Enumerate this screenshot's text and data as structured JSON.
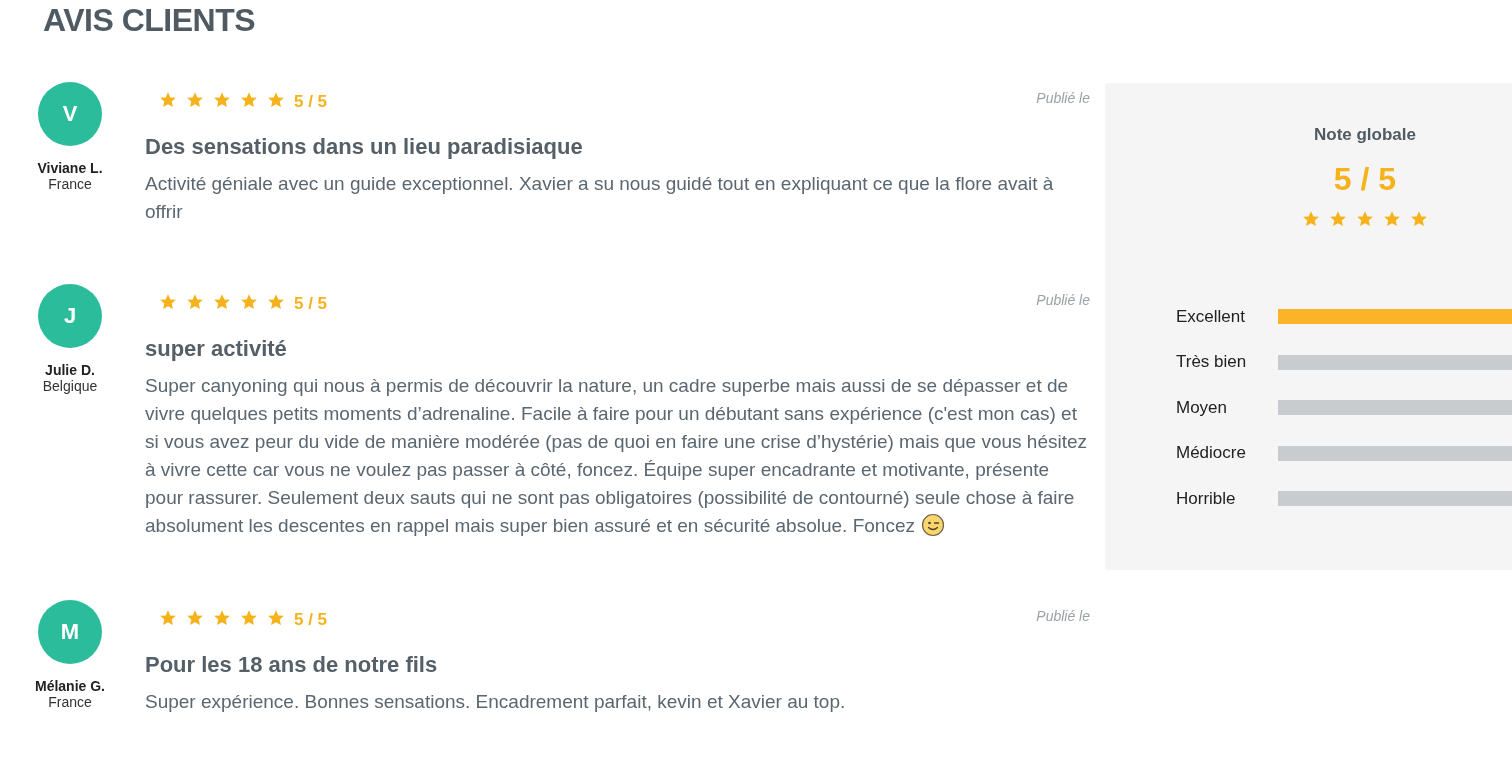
{
  "heading": "AVIS CLIENTS",
  "reviews": [
    {
      "initial": "V",
      "name": "Viviane L.",
      "country": "France",
      "stars": 5,
      "rating": "5 / 5",
      "published": "Publié le",
      "title": "Des sensations dans un lieu paradisiaque",
      "body": "Activité géniale avec un guide exceptionnel. Xavier a su nous guidé tout en expliquant ce que la flore avait à offrir",
      "emoji": false
    },
    {
      "initial": "J",
      "name": "Julie D.",
      "country": "Belgique",
      "stars": 5,
      "rating": "5 / 5",
      "published": "Publié le",
      "title": "super activité",
      "body": "Super canyoning qui nous à permis de découvrir la nature, un cadre superbe mais aussi de se dépasser et de vivre quelques petits moments d’adrenaline. Facile à faire pour un débutant sans expérience (c'est mon cas) et si vous avez peur du vide de manière modérée (pas de quoi en faire une crise d’hystérie) mais que vous hésitez à vivre cette car vous ne voulez pas passer à côté, foncez. Équipe super encadrante et motivante, présente pour rassurer. Seulement deux sauts qui ne sont pas obligatoires (possibilité de contourné) seule chose à faire absolument les descentes en rappel mais super bien assuré et en sécurité absolue. Foncez",
      "emoji": true
    },
    {
      "initial": "M",
      "name": "Mélanie G.",
      "country": "France",
      "stars": 5,
      "rating": "5 / 5",
      "published": "Publié le",
      "title": "Pour les 18 ans de notre fils",
      "body": "Super expérience. Bonnes sensations. Encadrement parfait, kevin et Xavier au top.",
      "emoji": false
    }
  ],
  "summary": {
    "title": "Note globale",
    "score": "5 / 5",
    "stars": 5,
    "distribution": [
      {
        "label": "Excellent",
        "level": 1
      },
      {
        "label": "Très bien",
        "level": 0
      },
      {
        "label": "Moyen",
        "level": 0
      },
      {
        "label": "Médiocre",
        "level": 0
      },
      {
        "label": "Horrible",
        "level": 0
      }
    ]
  }
}
